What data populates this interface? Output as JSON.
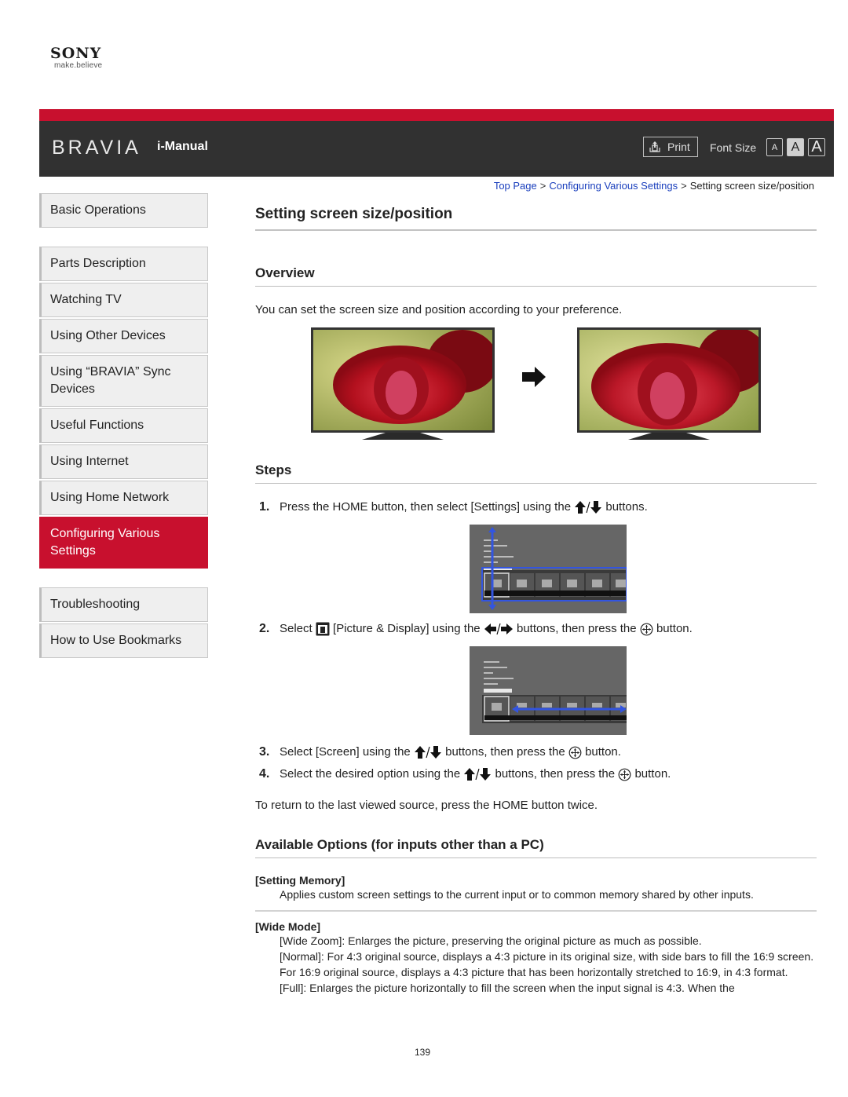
{
  "brand": {
    "company": "SONY",
    "tagline": "make.believe",
    "product": "BRAVIA",
    "manual": "i-Manual",
    "accent_color": "#c8102e",
    "header_bg": "#313131"
  },
  "toolbar": {
    "print_label": "Print",
    "font_size_label": "Font Size",
    "font_sizes": [
      "A",
      "A",
      "A"
    ]
  },
  "breadcrumb": {
    "items": [
      "Top Page",
      "Configuring Various Settings"
    ],
    "current": "Setting screen size/position",
    "separator": ">"
  },
  "sidebar": {
    "items": [
      {
        "label": "Basic Operations"
      },
      {
        "label": "Parts Description"
      },
      {
        "label": "Watching TV"
      },
      {
        "label": "Using Other Devices"
      },
      {
        "label": "Using “BRAVIA” Sync Devices"
      },
      {
        "label": "Useful Functions"
      },
      {
        "label": "Using Internet"
      },
      {
        "label": "Using Home Network"
      },
      {
        "label": "Configuring Various Settings",
        "active": true
      },
      {
        "label": "Troubleshooting"
      },
      {
        "label": "How to Use Bookmarks"
      }
    ]
  },
  "main": {
    "title": "Setting screen size/position",
    "overview": {
      "heading": "Overview",
      "text": "You can set the screen size and position according to your preference."
    },
    "steps": {
      "heading": "Steps",
      "items": [
        {
          "num": "1.",
          "pre": "Press the HOME button, then select [Settings] using the",
          "post": "buttons."
        },
        {
          "num": "2.",
          "pre": "Select",
          "mid1": "[Picture & Display] using the",
          "mid2": "buttons, then press the",
          "post": "button."
        },
        {
          "num": "3.",
          "pre": "Select [Screen] using the",
          "mid": "buttons, then press the",
          "post": "button."
        },
        {
          "num": "4.",
          "pre": "Select the desired option using the",
          "mid": "buttons, then press the",
          "post": "button."
        }
      ],
      "footer": "To return to the last viewed source, press the HOME button twice."
    },
    "options": {
      "heading": "Available Options (for inputs other than a PC)",
      "setting_memory": {
        "title": "[Setting Memory]",
        "desc": "Applies custom screen settings to the current input or to common memory shared by other inputs."
      },
      "wide_mode": {
        "title": "[Wide Mode]",
        "lines": [
          "[Wide Zoom]: Enlarges the picture, preserving the original picture as much as possible.",
          "[Normal]: For 4:3 original source, displays a 4:3 picture in its original size, with side bars to fill the 16:9 screen. For 16:9 original source, displays a 4:3 picture that has been horizontally stretched to 16:9, in 4:3 format.",
          "[Full]: Enlarges the picture horizontally to fill the screen when the input signal is 4:3. When the"
        ]
      }
    }
  },
  "page_number": "139"
}
